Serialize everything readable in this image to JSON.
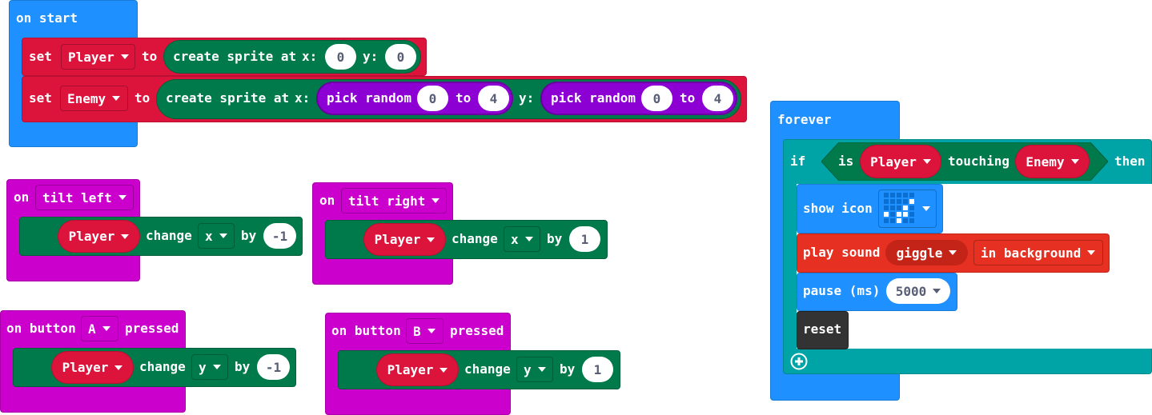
{
  "on_start": {
    "hat_label": "on start",
    "set_label": "set",
    "to_label": "to",
    "player_var": "Player",
    "enemy_var": "Enemy",
    "create_sprite_label": "create sprite at",
    "x_label": "x:",
    "y_label": "y:",
    "player_x": "0",
    "player_y": "0",
    "pick_random_label": "pick random",
    "random_to_label": "to",
    "rand_x_min": "0",
    "rand_x_max": "4",
    "rand_y_min": "0",
    "rand_y_max": "4"
  },
  "tilt_left": {
    "on_label": "on",
    "gesture": "tilt left",
    "sprite": "Player",
    "change_label": "change",
    "axis": "x",
    "by_label": "by",
    "value": "-1"
  },
  "tilt_right": {
    "on_label": "on",
    "gesture": "tilt right",
    "sprite": "Player",
    "change_label": "change",
    "axis": "x",
    "by_label": "by",
    "value": "1"
  },
  "button_a": {
    "on_button_label": "on button",
    "button": "A",
    "pressed_label": "pressed",
    "sprite": "Player",
    "change_label": "change",
    "axis": "y",
    "by_label": "by",
    "value": "-1"
  },
  "button_b": {
    "on_button_label": "on button",
    "button": "B",
    "pressed_label": "pressed",
    "sprite": "Player",
    "change_label": "change",
    "axis": "y",
    "by_label": "by",
    "value": "1"
  },
  "forever": {
    "hat_label": "forever",
    "if_label": "if",
    "is_label": "is",
    "sprite_a": "Player",
    "touching_label": "touching",
    "sprite_b": "Enemy",
    "then_label": "then",
    "show_icon_label": "show icon",
    "play_sound_label": "play sound",
    "sound": "giggle",
    "sound_mode": "in background",
    "pause_label": "pause (ms)",
    "pause_value": "5000",
    "reset_label": "reset"
  },
  "colors": {
    "events_hat": "#1e90ff",
    "input_hat": "#cc00cc",
    "variables": "#dc143c",
    "sprites": "#007a4b",
    "math": "#8c00d4",
    "logic": "#00a4a6",
    "music": "#e63022",
    "control": "#333333"
  },
  "icons": {
    "dropdown": "chevron-down-icon",
    "show_icon_preview": "led-icon-preview",
    "add_else": "plus-circle-icon"
  }
}
